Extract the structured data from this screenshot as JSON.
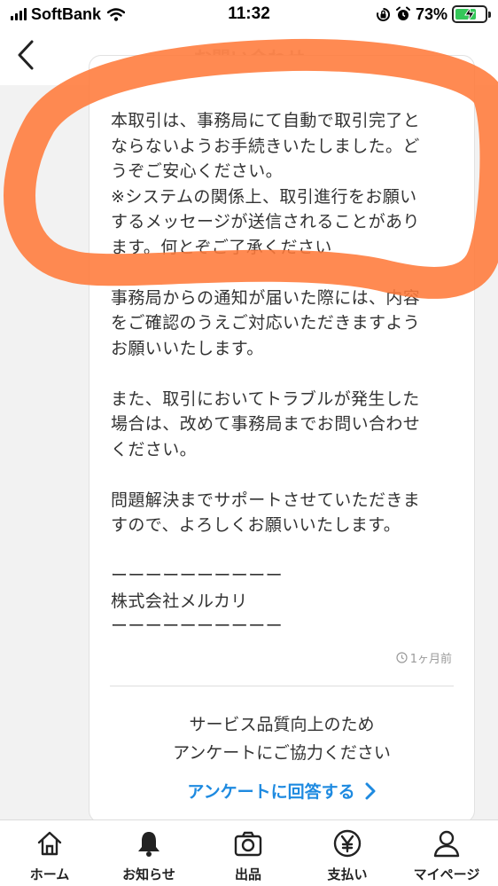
{
  "status_bar": {
    "carrier": "SoftBank",
    "time": "11:32",
    "battery": "73%",
    "battery_level": 0.73
  },
  "header": {
    "title": "お問い合わせ"
  },
  "message": {
    "paragraphs": [
      "本取引は、事務局にて自動で取引完了と\nならないようお手続きいたしました。ど\nうぞご安心ください。\n※システムの関係上、取引進行をお願い\nするメッセージが送信されることがあり\nます。何とぞご了承ください",
      "事務局からの通知が届いた際には、内容\nをご確認のうえご対応いただきますよう\nお願いいたします。",
      "また、取引においてトラブルが発生した\n場合は、改めて事務局までお問い合わせ\nください。",
      "問題解決までサポートさせていただきま\nすので、よろしくお願いいたします。",
      "ーーーーーーーーーー\n株式会社メルカリ\nーーーーーーーーーー"
    ],
    "timestamp": "1ヶ月前"
  },
  "survey": {
    "text": "サービス品質向上のため\nアンケートにご協力ください",
    "link": "アンケートに回答する"
  },
  "tabs": [
    {
      "label": "ホーム",
      "icon": "home-icon"
    },
    {
      "label": "お知らせ",
      "icon": "bell-icon"
    },
    {
      "label": "出品",
      "icon": "camera-icon"
    },
    {
      "label": "支払い",
      "icon": "yen-icon"
    },
    {
      "label": "マイページ",
      "icon": "person-icon"
    }
  ],
  "colors": {
    "accent_link": "#1e8ae0",
    "annotation": "#ff7a3a",
    "battery_fill": "#34c759"
  }
}
